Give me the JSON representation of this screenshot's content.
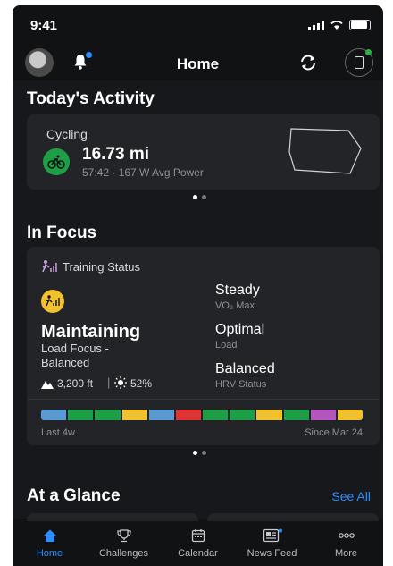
{
  "status_bar": {
    "time": "9:41"
  },
  "header": {
    "title": "Home"
  },
  "todays_activity": {
    "section_title": "Today's Activity",
    "activity_type": "Cycling",
    "distance": "16.73 mi",
    "details": "57:42 · 167 W Avg Power",
    "page_index": 1,
    "page_count": 2
  },
  "in_focus": {
    "section_title": "In Focus",
    "card_title": "Training Status",
    "status": "Maintaining",
    "load_focus_line1": "Load Focus -",
    "load_focus_line2": "Balanced",
    "altitude": "3,200 ft",
    "heat": "52%",
    "metrics": [
      {
        "value": "Steady",
        "label": "VO₂ Max"
      },
      {
        "value": "Optimal",
        "label": "Load"
      },
      {
        "value": "Balanced",
        "label": "HRV Status"
      }
    ],
    "history_colors": [
      "#5b9bd5",
      "#1f9e48",
      "#1f9e48",
      "#f2c12e",
      "#5b9bd5",
      "#e03434",
      "#1f9e48",
      "#1f9e48",
      "#f2c12e",
      "#1f9e48",
      "#b455c0",
      "#f2c12e"
    ],
    "range_start": "Last 4w",
    "range_end": "Since Mar 24",
    "page_index": 1,
    "page_count": 2
  },
  "at_a_glance": {
    "section_title": "At a Glance",
    "see_all": "See All"
  },
  "tabs": [
    {
      "label": "Home",
      "icon": "home-icon",
      "active": true
    },
    {
      "label": "Challenges",
      "icon": "challenges-icon",
      "active": false
    },
    {
      "label": "Calendar",
      "icon": "calendar-icon",
      "active": false
    },
    {
      "label": "News Feed",
      "icon": "news-feed-icon",
      "active": false
    },
    {
      "label": "More",
      "icon": "more-icon",
      "active": false
    }
  ],
  "colors": {
    "accent": "#2f8cff",
    "cycling": "#1f9e48",
    "training": "#f2c12e"
  }
}
